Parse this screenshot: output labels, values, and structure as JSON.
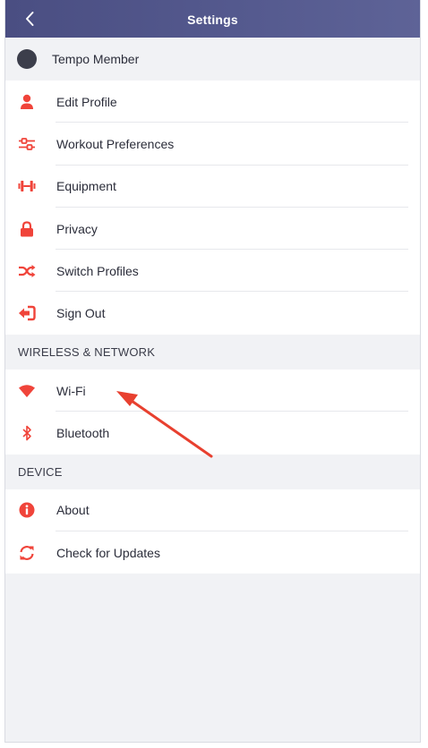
{
  "header": {
    "title": "Settings",
    "background": "#555a8f"
  },
  "account": {
    "member_name": "Tempo Member"
  },
  "account_menu": [
    {
      "label": "Edit Profile",
      "icon": "person-icon"
    },
    {
      "label": "Workout Preferences",
      "icon": "sliders-icon"
    },
    {
      "label": "Equipment",
      "icon": "dumbbell-icon"
    },
    {
      "label": "Privacy",
      "icon": "lock-icon"
    },
    {
      "label": "Switch Profiles",
      "icon": "shuffle-icon"
    },
    {
      "label": "Sign Out",
      "icon": "sign-out-icon"
    }
  ],
  "wireless": {
    "section_title": "WIRELESS & NETWORK",
    "items": [
      {
        "label": "Wi-Fi",
        "icon": "wifi-icon"
      },
      {
        "label": "Bluetooth",
        "icon": "bluetooth-icon"
      }
    ]
  },
  "device": {
    "section_title": "DEVICE",
    "items": [
      {
        "label": "About",
        "icon": "info-icon"
      },
      {
        "label": "Check for Updates",
        "icon": "refresh-icon"
      }
    ]
  },
  "colors": {
    "accent": "#f0443a",
    "annotation_arrow": "#e8402f"
  }
}
